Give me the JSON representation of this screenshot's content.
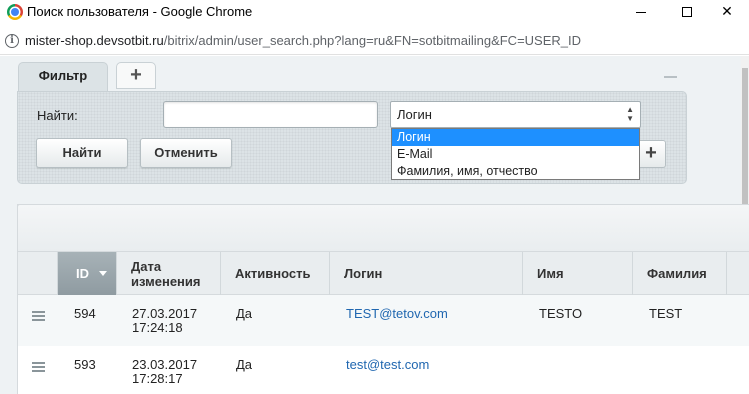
{
  "window": {
    "title": "Поиск пользователя - Google Chrome",
    "controls": {
      "minimize": "–",
      "maximize": "☐",
      "close": "✕"
    }
  },
  "urlbar": {
    "host": "mister-shop.devsotbit.ru",
    "path": "/bitrix/admin/user_search.php?lang=ru&FN=sotbitmailing&FC=USER_ID"
  },
  "filter": {
    "tab_label": "Фильтр",
    "add_tab_label": "+",
    "find_label": "Найти:",
    "find_value": "",
    "select_value": "Логин",
    "options": [
      "Логин",
      "E-Mail",
      "Фамилия, имя, отчество"
    ],
    "selected_option_index": 0,
    "find_button": "Найти",
    "cancel_button": "Отменить",
    "plus_button": "+"
  },
  "grid": {
    "columns": [
      "ID",
      "Дата изменения",
      "Активность",
      "Логин",
      "Имя",
      "Фамилия"
    ],
    "rows": [
      {
        "id": "594",
        "date": "27.03.2017",
        "time": "17:24:18",
        "active": "Да",
        "login": "TEST@tetov.com",
        "name": "TESTO",
        "surname": "TEST"
      },
      {
        "id": "593",
        "date": "23.03.2017",
        "time": "17:28:17",
        "active": "Да",
        "login": "test@test.com",
        "name": "",
        "surname": ""
      }
    ]
  },
  "colors": {
    "accent": "#1e90ff",
    "link": "#2067b0",
    "panel": "#dce3e6"
  }
}
